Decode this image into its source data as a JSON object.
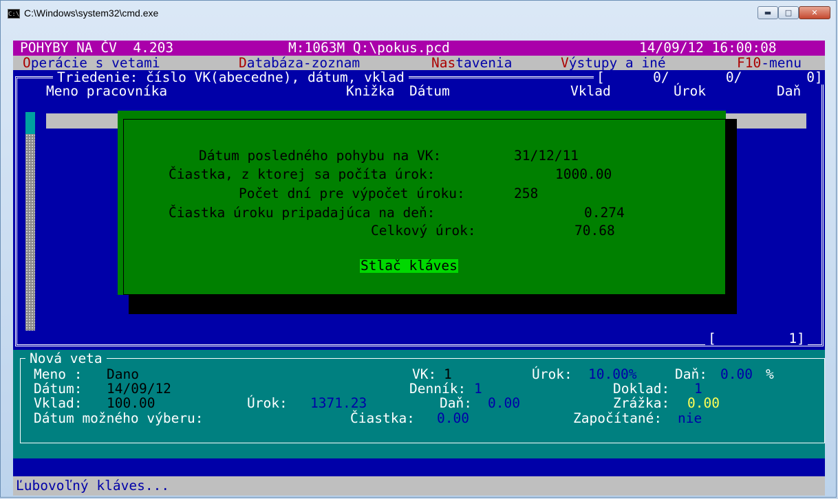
{
  "window": {
    "title": "C:\\Windows\\system32\\cmd.exe",
    "icon": "cmd-icon",
    "buttons": {
      "minimize": "▬",
      "maximize": "□",
      "close": "✕"
    }
  },
  "status_top": {
    "app": "POHYBY NA ČV  4.203",
    "file": "M:1063M Q:\\pokus.pcd",
    "datetime": "14/09/12 16:00:08"
  },
  "menu": [
    {
      "hot": "O",
      "rest": "perácie s vetami"
    },
    {
      "hot": "D",
      "rest": "atabáza-zoznam"
    },
    {
      "hot": "Nas",
      "rest": "tavenia"
    },
    {
      "hot": "V",
      "rest": "ýstupy a iné"
    },
    {
      "hot": "F10",
      "rest": "-menu"
    }
  ],
  "list": {
    "sort_label": "Triedenie: číslo VK(abecedne), dátum, vklad",
    "counters": "[      0/       0/        0]",
    "columns": {
      "name": "Meno pracovníka",
      "book": "Knižka",
      "date": "Dátum",
      "deposit": "Vklad",
      "interest": "Úrok",
      "tax": "Daň"
    },
    "page_indicator": "[         1]"
  },
  "dialog": {
    "rows": [
      {
        "label": "Dátum posledného pohybu na VK:",
        "value": "31/12/11"
      },
      {
        "label": "Čiastka, z ktorej sa počíta úrok:",
        "value": "1000.00"
      },
      {
        "label": "Počet dní pre výpočet úroku:",
        "value": "258"
      },
      {
        "label": "Čiastka úroku pripadajúca na deň:",
        "value": "0.274"
      },
      {
        "label": "Celkový úrok:",
        "value": "70.68"
      }
    ],
    "button": "Stlač kláves"
  },
  "record": {
    "title": "Nová veta",
    "name_label": "Meno :",
    "name_value": "Dano",
    "vk_label": "VK:",
    "vk_value": "1",
    "rate_label": "Úrok:",
    "rate_value": "10.00%",
    "tax_rate_label": "Daň:",
    "tax_rate_value": "0.00",
    "tax_rate_unit": "%",
    "date_label": "Dátum:",
    "date_value": "14/09/12",
    "journal_label": "Denník:",
    "journal_value": "1",
    "doc_label": "Doklad:",
    "doc_value": "1",
    "deposit_label": "Vklad:",
    "deposit_value": "100.00",
    "interest_label": "Úrok:",
    "interest_value": "1371.23",
    "tax_label": "Daň:",
    "tax_value": "0.00",
    "deduction_label": "Zrážka:",
    "deduction_value": "0.00",
    "withdraw_label": "Dátum možného výberu:",
    "amount_label": "Čiastka:",
    "amount_value": "0.00",
    "counted_label": "Započítané:",
    "counted_value": "nie"
  },
  "footer": {
    "prompt": "Ľubovoľný kláves..."
  },
  "colors": {
    "magenta": "#aa00aa",
    "blue": "#0000a8",
    "green": "#008000",
    "bright_green": "#00d800",
    "teal": "#008080",
    "gray": "#bfbfbf",
    "yellow": "#ffff55",
    "dark_red": "#aa0000"
  }
}
